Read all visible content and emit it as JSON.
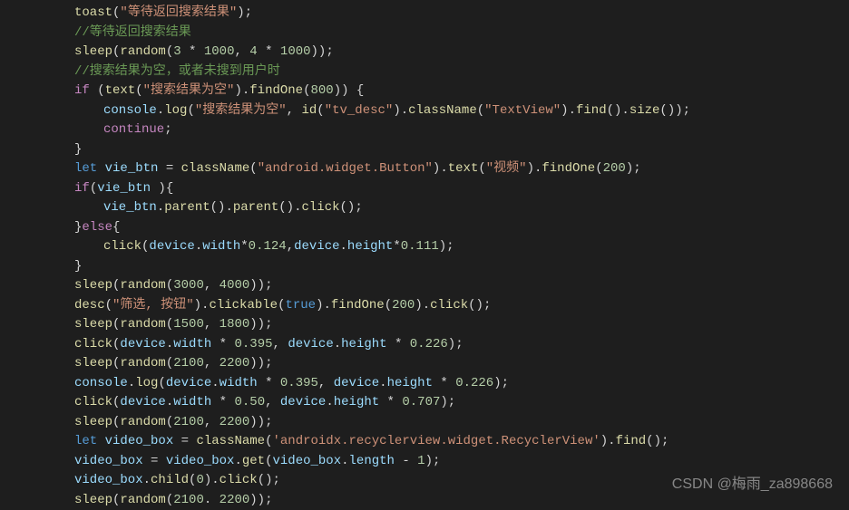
{
  "code": {
    "lines": [
      {
        "indent": 0,
        "tokens": [
          {
            "cls": "func",
            "t": "toast"
          },
          {
            "cls": "plain",
            "t": "("
          },
          {
            "cls": "string",
            "t": "\"等待返回搜索结果\""
          },
          {
            "cls": "plain",
            "t": ");"
          }
        ]
      },
      {
        "indent": 0,
        "tokens": [
          {
            "cls": "comment",
            "t": "//等待返回搜索结果"
          }
        ]
      },
      {
        "indent": 0,
        "tokens": [
          {
            "cls": "func",
            "t": "sleep"
          },
          {
            "cls": "plain",
            "t": "("
          },
          {
            "cls": "func",
            "t": "random"
          },
          {
            "cls": "plain",
            "t": "("
          },
          {
            "cls": "number",
            "t": "3"
          },
          {
            "cls": "plain",
            "t": " * "
          },
          {
            "cls": "number",
            "t": "1000"
          },
          {
            "cls": "plain",
            "t": ", "
          },
          {
            "cls": "number",
            "t": "4"
          },
          {
            "cls": "plain",
            "t": " * "
          },
          {
            "cls": "number",
            "t": "1000"
          },
          {
            "cls": "plain",
            "t": "));"
          }
        ]
      },
      {
        "indent": 0,
        "tokens": [
          {
            "cls": "comment",
            "t": "//搜索结果为空，或者未搜到用户时"
          }
        ]
      },
      {
        "indent": 0,
        "tokens": [
          {
            "cls": "keyword-ctrl",
            "t": "if"
          },
          {
            "cls": "plain",
            "t": " ("
          },
          {
            "cls": "func",
            "t": "text"
          },
          {
            "cls": "plain",
            "t": "("
          },
          {
            "cls": "string",
            "t": "\"搜索结果为空\""
          },
          {
            "cls": "plain",
            "t": ")."
          },
          {
            "cls": "func",
            "t": "findOne"
          },
          {
            "cls": "plain",
            "t": "("
          },
          {
            "cls": "number",
            "t": "800"
          },
          {
            "cls": "plain",
            "t": ")) {"
          }
        ]
      },
      {
        "indent": 1,
        "tokens": [
          {
            "cls": "var",
            "t": "console"
          },
          {
            "cls": "plain",
            "t": "."
          },
          {
            "cls": "func",
            "t": "log"
          },
          {
            "cls": "plain",
            "t": "("
          },
          {
            "cls": "string",
            "t": "\"搜索结果为空\""
          },
          {
            "cls": "plain",
            "t": ", "
          },
          {
            "cls": "func",
            "t": "id"
          },
          {
            "cls": "plain",
            "t": "("
          },
          {
            "cls": "string",
            "t": "\"tv_desc\""
          },
          {
            "cls": "plain",
            "t": ")."
          },
          {
            "cls": "func",
            "t": "className"
          },
          {
            "cls": "plain",
            "t": "("
          },
          {
            "cls": "string",
            "t": "\"TextView\""
          },
          {
            "cls": "plain",
            "t": ")."
          },
          {
            "cls": "func",
            "t": "find"
          },
          {
            "cls": "plain",
            "t": "()."
          },
          {
            "cls": "func",
            "t": "size"
          },
          {
            "cls": "plain",
            "t": "());"
          }
        ]
      },
      {
        "indent": 1,
        "tokens": [
          {
            "cls": "keyword-ctrl",
            "t": "continue"
          },
          {
            "cls": "plain",
            "t": ";"
          }
        ]
      },
      {
        "indent": 0,
        "tokens": [
          {
            "cls": "plain",
            "t": "}"
          }
        ]
      },
      {
        "indent": 0,
        "tokens": [
          {
            "cls": "keyword",
            "t": "let"
          },
          {
            "cls": "plain",
            "t": " "
          },
          {
            "cls": "var",
            "t": "vie_btn"
          },
          {
            "cls": "plain",
            "t": " = "
          },
          {
            "cls": "func",
            "t": "className"
          },
          {
            "cls": "plain",
            "t": "("
          },
          {
            "cls": "string",
            "t": "\"android.widget.Button\""
          },
          {
            "cls": "plain",
            "t": ")."
          },
          {
            "cls": "func",
            "t": "text"
          },
          {
            "cls": "plain",
            "t": "("
          },
          {
            "cls": "string",
            "t": "\"视频\""
          },
          {
            "cls": "plain",
            "t": ")."
          },
          {
            "cls": "func",
            "t": "findOne"
          },
          {
            "cls": "plain",
            "t": "("
          },
          {
            "cls": "number",
            "t": "200"
          },
          {
            "cls": "plain",
            "t": ");"
          }
        ]
      },
      {
        "indent": 0,
        "tokens": [
          {
            "cls": "keyword-ctrl",
            "t": "if"
          },
          {
            "cls": "plain",
            "t": "("
          },
          {
            "cls": "var",
            "t": "vie_btn"
          },
          {
            "cls": "plain",
            "t": " ){"
          }
        ]
      },
      {
        "indent": 1,
        "tokens": [
          {
            "cls": "var",
            "t": "vie_btn"
          },
          {
            "cls": "plain",
            "t": "."
          },
          {
            "cls": "func",
            "t": "parent"
          },
          {
            "cls": "plain",
            "t": "()."
          },
          {
            "cls": "func",
            "t": "parent"
          },
          {
            "cls": "plain",
            "t": "()."
          },
          {
            "cls": "func",
            "t": "click"
          },
          {
            "cls": "plain",
            "t": "();"
          }
        ]
      },
      {
        "indent": 0,
        "tokens": [
          {
            "cls": "plain",
            "t": "}"
          },
          {
            "cls": "keyword-ctrl",
            "t": "else"
          },
          {
            "cls": "plain",
            "t": "{"
          }
        ]
      },
      {
        "indent": 1,
        "tokens": [
          {
            "cls": "func",
            "t": "click"
          },
          {
            "cls": "plain",
            "t": "("
          },
          {
            "cls": "var",
            "t": "device"
          },
          {
            "cls": "plain",
            "t": "."
          },
          {
            "cls": "prop",
            "t": "width"
          },
          {
            "cls": "plain",
            "t": "*"
          },
          {
            "cls": "number",
            "t": "0.124"
          },
          {
            "cls": "plain",
            "t": ","
          },
          {
            "cls": "var",
            "t": "device"
          },
          {
            "cls": "plain",
            "t": "."
          },
          {
            "cls": "prop",
            "t": "height"
          },
          {
            "cls": "plain",
            "t": "*"
          },
          {
            "cls": "number",
            "t": "0.111"
          },
          {
            "cls": "plain",
            "t": ");"
          }
        ]
      },
      {
        "indent": 0,
        "tokens": [
          {
            "cls": "plain",
            "t": "}"
          }
        ]
      },
      {
        "indent": 0,
        "tokens": [
          {
            "cls": "func",
            "t": "sleep"
          },
          {
            "cls": "plain",
            "t": "("
          },
          {
            "cls": "func",
            "t": "random"
          },
          {
            "cls": "plain",
            "t": "("
          },
          {
            "cls": "number",
            "t": "3000"
          },
          {
            "cls": "plain",
            "t": ", "
          },
          {
            "cls": "number",
            "t": "4000"
          },
          {
            "cls": "plain",
            "t": "));"
          }
        ]
      },
      {
        "indent": 0,
        "tokens": [
          {
            "cls": "func",
            "t": "desc"
          },
          {
            "cls": "plain",
            "t": "("
          },
          {
            "cls": "string",
            "t": "\"筛选, 按钮\""
          },
          {
            "cls": "plain",
            "t": ")."
          },
          {
            "cls": "func",
            "t": "clickable"
          },
          {
            "cls": "plain",
            "t": "("
          },
          {
            "cls": "const",
            "t": "true"
          },
          {
            "cls": "plain",
            "t": ")."
          },
          {
            "cls": "func",
            "t": "findOne"
          },
          {
            "cls": "plain",
            "t": "("
          },
          {
            "cls": "number",
            "t": "200"
          },
          {
            "cls": "plain",
            "t": ")."
          },
          {
            "cls": "func",
            "t": "click"
          },
          {
            "cls": "plain",
            "t": "();"
          }
        ]
      },
      {
        "indent": 0,
        "tokens": [
          {
            "cls": "func",
            "t": "sleep"
          },
          {
            "cls": "plain",
            "t": "("
          },
          {
            "cls": "func",
            "t": "random"
          },
          {
            "cls": "plain",
            "t": "("
          },
          {
            "cls": "number",
            "t": "1500"
          },
          {
            "cls": "plain",
            "t": ", "
          },
          {
            "cls": "number",
            "t": "1800"
          },
          {
            "cls": "plain",
            "t": "));"
          }
        ]
      },
      {
        "indent": 0,
        "tokens": [
          {
            "cls": "func",
            "t": "click"
          },
          {
            "cls": "plain",
            "t": "("
          },
          {
            "cls": "var",
            "t": "device"
          },
          {
            "cls": "plain",
            "t": "."
          },
          {
            "cls": "prop",
            "t": "width"
          },
          {
            "cls": "plain",
            "t": " * "
          },
          {
            "cls": "number",
            "t": "0.395"
          },
          {
            "cls": "plain",
            "t": ", "
          },
          {
            "cls": "var",
            "t": "device"
          },
          {
            "cls": "plain",
            "t": "."
          },
          {
            "cls": "prop",
            "t": "height"
          },
          {
            "cls": "plain",
            "t": " * "
          },
          {
            "cls": "number",
            "t": "0.226"
          },
          {
            "cls": "plain",
            "t": ");"
          }
        ]
      },
      {
        "indent": 0,
        "tokens": [
          {
            "cls": "func",
            "t": "sleep"
          },
          {
            "cls": "plain",
            "t": "("
          },
          {
            "cls": "func",
            "t": "random"
          },
          {
            "cls": "plain",
            "t": "("
          },
          {
            "cls": "number",
            "t": "2100"
          },
          {
            "cls": "plain",
            "t": ", "
          },
          {
            "cls": "number",
            "t": "2200"
          },
          {
            "cls": "plain",
            "t": "));"
          }
        ]
      },
      {
        "indent": 0,
        "tokens": [
          {
            "cls": "var",
            "t": "console"
          },
          {
            "cls": "plain",
            "t": "."
          },
          {
            "cls": "func",
            "t": "log"
          },
          {
            "cls": "plain",
            "t": "("
          },
          {
            "cls": "var",
            "t": "device"
          },
          {
            "cls": "plain",
            "t": "."
          },
          {
            "cls": "prop",
            "t": "width"
          },
          {
            "cls": "plain",
            "t": " * "
          },
          {
            "cls": "number",
            "t": "0.395"
          },
          {
            "cls": "plain",
            "t": ", "
          },
          {
            "cls": "var",
            "t": "device"
          },
          {
            "cls": "plain",
            "t": "."
          },
          {
            "cls": "prop",
            "t": "height"
          },
          {
            "cls": "plain",
            "t": " * "
          },
          {
            "cls": "number",
            "t": "0.226"
          },
          {
            "cls": "plain",
            "t": ");"
          }
        ]
      },
      {
        "indent": 0,
        "tokens": [
          {
            "cls": "func",
            "t": "click"
          },
          {
            "cls": "plain",
            "t": "("
          },
          {
            "cls": "var",
            "t": "device"
          },
          {
            "cls": "plain",
            "t": "."
          },
          {
            "cls": "prop",
            "t": "width"
          },
          {
            "cls": "plain",
            "t": " * "
          },
          {
            "cls": "number",
            "t": "0.50"
          },
          {
            "cls": "plain",
            "t": ", "
          },
          {
            "cls": "var",
            "t": "device"
          },
          {
            "cls": "plain",
            "t": "."
          },
          {
            "cls": "prop",
            "t": "height"
          },
          {
            "cls": "plain",
            "t": " * "
          },
          {
            "cls": "number",
            "t": "0.707"
          },
          {
            "cls": "plain",
            "t": ");"
          }
        ]
      },
      {
        "indent": 0,
        "tokens": [
          {
            "cls": "func",
            "t": "sleep"
          },
          {
            "cls": "plain",
            "t": "("
          },
          {
            "cls": "func",
            "t": "random"
          },
          {
            "cls": "plain",
            "t": "("
          },
          {
            "cls": "number",
            "t": "2100"
          },
          {
            "cls": "plain",
            "t": ", "
          },
          {
            "cls": "number",
            "t": "2200"
          },
          {
            "cls": "plain",
            "t": "));"
          }
        ]
      },
      {
        "indent": 0,
        "tokens": [
          {
            "cls": "keyword",
            "t": "let"
          },
          {
            "cls": "plain",
            "t": " "
          },
          {
            "cls": "var",
            "t": "video_box"
          },
          {
            "cls": "plain",
            "t": " = "
          },
          {
            "cls": "func",
            "t": "className"
          },
          {
            "cls": "plain",
            "t": "("
          },
          {
            "cls": "string",
            "t": "'androidx.recyclerview.widget.RecyclerView'"
          },
          {
            "cls": "plain",
            "t": ")."
          },
          {
            "cls": "func",
            "t": "find"
          },
          {
            "cls": "plain",
            "t": "();"
          }
        ]
      },
      {
        "indent": 0,
        "tokens": [
          {
            "cls": "var",
            "t": "video_box"
          },
          {
            "cls": "plain",
            "t": " = "
          },
          {
            "cls": "var",
            "t": "video_box"
          },
          {
            "cls": "plain",
            "t": "."
          },
          {
            "cls": "func",
            "t": "get"
          },
          {
            "cls": "plain",
            "t": "("
          },
          {
            "cls": "var",
            "t": "video_box"
          },
          {
            "cls": "plain",
            "t": "."
          },
          {
            "cls": "prop",
            "t": "length"
          },
          {
            "cls": "plain",
            "t": " - "
          },
          {
            "cls": "number",
            "t": "1"
          },
          {
            "cls": "plain",
            "t": ");"
          }
        ]
      },
      {
        "indent": 0,
        "tokens": [
          {
            "cls": "var",
            "t": "video_box"
          },
          {
            "cls": "plain",
            "t": "."
          },
          {
            "cls": "func",
            "t": "child"
          },
          {
            "cls": "plain",
            "t": "("
          },
          {
            "cls": "number",
            "t": "0"
          },
          {
            "cls": "plain",
            "t": ")."
          },
          {
            "cls": "func",
            "t": "click"
          },
          {
            "cls": "plain",
            "t": "();"
          }
        ]
      },
      {
        "indent": 0,
        "tokens": [
          {
            "cls": "func",
            "t": "sleep"
          },
          {
            "cls": "plain",
            "t": "("
          },
          {
            "cls": "func",
            "t": "random"
          },
          {
            "cls": "plain",
            "t": "("
          },
          {
            "cls": "number",
            "t": "2100"
          },
          {
            "cls": "plain",
            "t": ". "
          },
          {
            "cls": "number",
            "t": "2200"
          },
          {
            "cls": "plain",
            "t": "));"
          }
        ]
      }
    ]
  },
  "watermark": "CSDN @梅雨_za898668"
}
